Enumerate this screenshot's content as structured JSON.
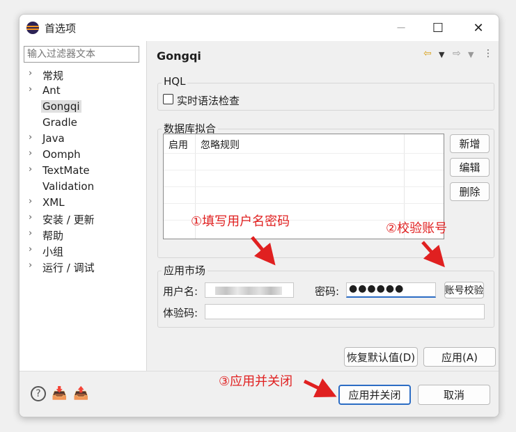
{
  "window": {
    "title": "首选项",
    "minimize": "─",
    "maximize": "☐",
    "close": "✕"
  },
  "filter": {
    "placeholder": "输入过滤器文本"
  },
  "tree": [
    {
      "label": "常规",
      "expandable": true
    },
    {
      "label": "Ant",
      "expandable": true
    },
    {
      "label": "Gongqi",
      "expandable": false,
      "selected": true
    },
    {
      "label": "Gradle",
      "expandable": false
    },
    {
      "label": "Java",
      "expandable": true
    },
    {
      "label": "Oomph",
      "expandable": true
    },
    {
      "label": "TextMate",
      "expandable": true
    },
    {
      "label": "Validation",
      "expandable": false
    },
    {
      "label": "XML",
      "expandable": true
    },
    {
      "label": "安装 / 更新",
      "expandable": true
    },
    {
      "label": "帮助",
      "expandable": true
    },
    {
      "label": "小组",
      "expandable": true
    },
    {
      "label": "运行 / 调试",
      "expandable": true
    }
  ],
  "page": {
    "title": "Gongqi",
    "hql": {
      "title": "HQL",
      "realtime_check": "实时语法检查",
      "checked": false
    },
    "db_fit": {
      "title": "数据库拟合",
      "columns": [
        "启用",
        "忽略规则"
      ],
      "add": "新增",
      "edit": "编辑",
      "delete": "删除"
    },
    "market": {
      "title": "应用市场",
      "username_label": "用户名:",
      "password_label": "密码:",
      "password_value": "●●●●●●",
      "verify_button": "账号校验",
      "trial_code_label": "体验码:"
    },
    "restore_defaults": "恢复默认值(D)",
    "apply": "应用(A)"
  },
  "footer": {
    "apply_close": "应用并关闭",
    "cancel": "取消"
  },
  "annotations": {
    "step1": "①填写用户名密码",
    "step2": "②校验账号",
    "step3": "③应用并关闭"
  },
  "colors": {
    "annotation": "#e02020",
    "primary_border": "#2b6cc4"
  }
}
